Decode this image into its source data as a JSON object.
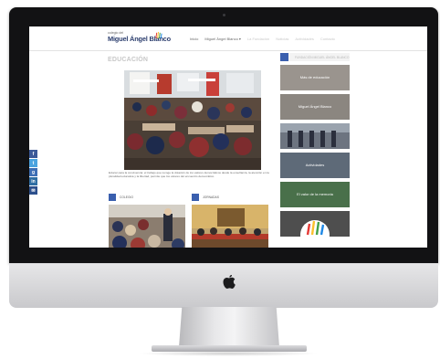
{
  "site": {
    "logo_top": "colegio del",
    "logo_main": "Miguel Ángel Blanco"
  },
  "nav": [
    {
      "label": "Inicio",
      "state": "active"
    },
    {
      "label": "Miguel Ángel Blanco ▾",
      "state": "active"
    },
    {
      "label": "La Fundación",
      "state": "faded"
    },
    {
      "label": "Noticias",
      "state": "faded"
    },
    {
      "label": "Actividades",
      "state": "faded"
    },
    {
      "label": "Contacto",
      "state": "faded"
    }
  ],
  "page": {
    "title": "EDUCACIÓN",
    "intro": "Educar para la convivencia: el trabajo que recoge la dotación de los valores democráticos desde la enseñanza, la atención en la pluralidad educativa y la libertad, permite que los valores del encuentro democrático."
  },
  "sections": [
    {
      "label": "COLEGIO"
    },
    {
      "label": "JORNADAS"
    }
  ],
  "social": [
    {
      "glyph": "f",
      "color": "#3b5998",
      "icon": "facebook-icon"
    },
    {
      "glyph": "t",
      "color": "#4aa3df",
      "icon": "twitter-icon"
    },
    {
      "glyph": "g",
      "color": "#3d6eb5",
      "icon": "google-icon"
    },
    {
      "glyph": "in",
      "color": "#2f6ea3",
      "icon": "linkedin-icon"
    },
    {
      "glyph": "✉",
      "color": "#2c4f8c",
      "icon": "email-icon"
    }
  ],
  "sidebar": {
    "heading": "FUNDACIÓN MIGUEL ÁNGEL BLANCO",
    "tiles": [
      {
        "caption": "Más de educación",
        "color": "#9a948e"
      },
      {
        "caption": "Miguel Ángel Blanco",
        "color": "#8b8680"
      },
      {
        "caption": "",
        "color": "#6d7480"
      },
      {
        "caption": "Actividades",
        "color": "#5e6a78"
      },
      {
        "caption": "El valor de la memoria",
        "color": "#49704a"
      },
      {
        "caption": "",
        "color": "#5a5a5a"
      }
    ]
  },
  "colors": {
    "accent": "#3a5fae",
    "bezel": "#121214",
    "screen_bg": "#f1f1f1"
  }
}
